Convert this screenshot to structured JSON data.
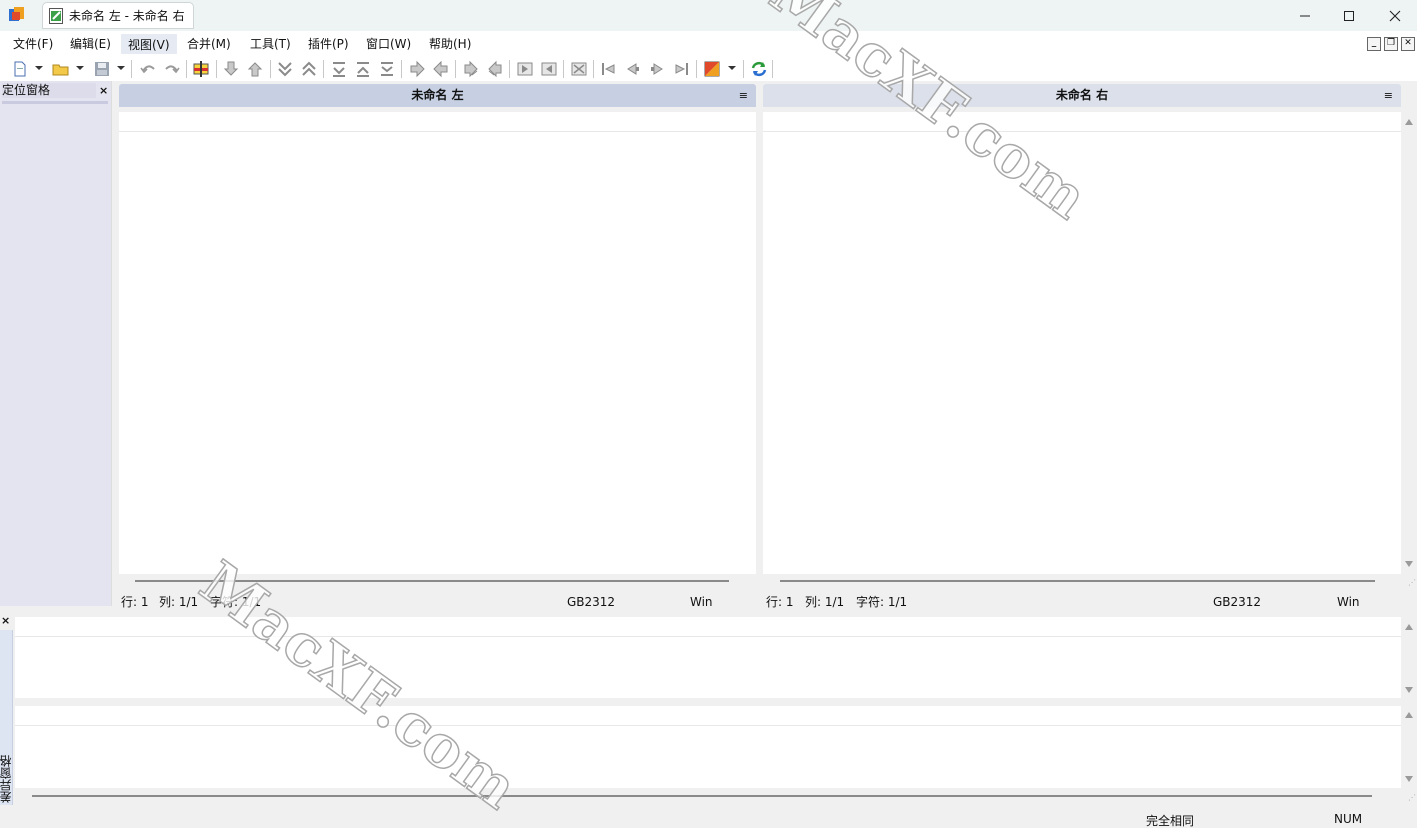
{
  "window": {
    "tab_title": "未命名 左 - 未命名 右",
    "controls": {
      "minimize": "—",
      "maximize": "☐",
      "close": "✕"
    }
  },
  "menu": {
    "items": [
      "文件(F)",
      "编辑(E)",
      "视图(V)",
      "合并(M)",
      "工具(T)",
      "插件(P)",
      "窗口(W)",
      "帮助(H)"
    ],
    "active": "视图(V)"
  },
  "toolbar": {
    "icons": [
      "new-document-icon",
      "open-folder-icon",
      "save-icon",
      "undo-icon",
      "redo-icon",
      "options-flag-icon",
      "next-diff-down-icon",
      "prev-diff-up-icon",
      "first-diff-icon",
      "last-diff-icon",
      "next-conflict-icon",
      "prev-conflict-icon",
      "all-diffs-icon",
      "copy-right-icon",
      "copy-left-icon",
      "copy-right-advance-icon",
      "copy-left-advance-icon",
      "copy-all-right-icon",
      "copy-all-left-icon",
      "merge-icon",
      "go-first-icon",
      "go-prev-icon",
      "go-next-icon",
      "go-last-icon",
      "color-scheme-icon",
      "refresh-icon"
    ]
  },
  "location_pane": {
    "title": "定位窗格",
    "close": "×"
  },
  "left_pane": {
    "header": "未命名 左",
    "menu": "≡",
    "status": {
      "line": "行: 1",
      "col": "列: 1/1",
      "char": "字符: 1/1",
      "encoding": "GB2312",
      "eol": "Win"
    }
  },
  "right_pane": {
    "header": "未命名 右",
    "menu": "≡",
    "status": {
      "line": "行: 1",
      "col": "列: 1/1",
      "char": "字符: 1/1",
      "encoding": "GB2312",
      "eol": "Win"
    }
  },
  "diff_pane": {
    "close": "×",
    "label": "差异窗格"
  },
  "status_bar": {
    "message": "完全相同",
    "num": "NUM"
  },
  "watermark": "MacXF.com"
}
